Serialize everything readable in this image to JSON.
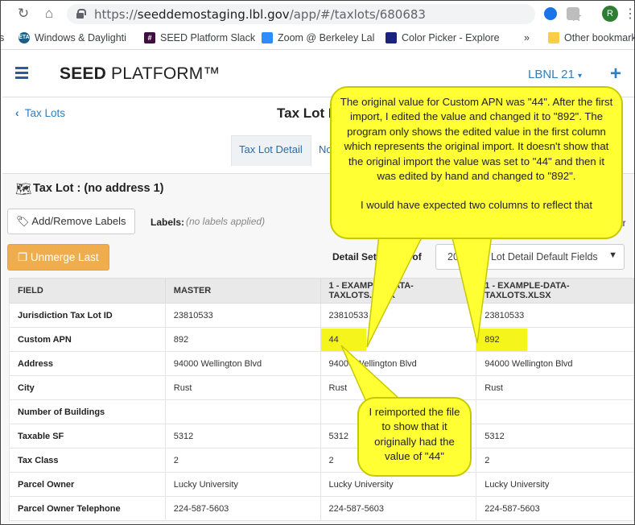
{
  "browser": {
    "url_host": "seeddemostaging.lbl.gov",
    "url_path": "/app/#/taxlots/680683",
    "url_scheme": "https://",
    "avatar_letter": "R",
    "bookmarks": [
      {
        "label": "Windows & Daylighti",
        "icon": "ETA"
      },
      {
        "label": "SEED Platform Slack",
        "icon": "#"
      },
      {
        "label": "Zoom @ Berkeley Lal",
        "icon": "zoom"
      },
      {
        "label": "Color Picker - Explore",
        "icon": "color"
      }
    ],
    "overflow": "»",
    "other_bookmarks": "Other bookmark"
  },
  "app": {
    "brand_bold": "SEED",
    "brand_light": " PLATFORM™",
    "org": "LBNL 21",
    "back_link": "Tax Lots",
    "page_title": "Tax Lot D",
    "tabs": [
      "Tax Lot Detail",
      "No"
    ],
    "section_title": "Tax Lot : (no address 1)",
    "labels_button": "Add/Remove Labels",
    "labels_caption": "Labels:",
    "labels_value": "(no labels applied)",
    "unmerge_button": "Unmerge Last",
    "detail_settings_label": "Detail Settings Prof",
    "detail_settings_value": "2016 Tax Lot Detail Default Fields",
    "edge_fragment_1": "t",
    "edge_fragment_2": "ar"
  },
  "table": {
    "headers": [
      "FIELD",
      "MASTER",
      "1 - EXAMPLE-DATA-TAXLOTS.XLSX",
      "1 - EXAMPLE-DATA-TAXLOTS.XLSX"
    ],
    "rows": [
      [
        "Jurisdiction Tax Lot ID",
        "23810533",
        "23810533",
        "23810533"
      ],
      [
        "Custom APN",
        "892",
        "44",
        "892"
      ],
      [
        "Address",
        "94000 Wellington Blvd",
        "94000 Wellington Blvd",
        "94000 Wellington Blvd"
      ],
      [
        "City",
        "Rust",
        "Rust",
        "Rust"
      ],
      [
        "Number of Buildings",
        "",
        "",
        ""
      ],
      [
        "Taxable SF",
        "5312",
        "5312",
        "5312"
      ],
      [
        "Tax Class",
        "2",
        "2",
        "2"
      ],
      [
        "Parcel Owner",
        "Lucky University",
        "Lucky University",
        "Lucky University"
      ],
      [
        "Parcel Owner Telephone",
        "224-587-5603",
        "224-587-5603",
        "224-587-5603"
      ]
    ]
  },
  "annotations": {
    "callout_top": "The original value for Custom APN was \"44\". After the first import, I edited the value and changed it to \"892\". The program only shows the edited value in the first column which represents the original import. It doesn't show that the original import the value was set to \"44\" and then it was edited by hand and changed to \"892\".",
    "callout_top_2": "I would have expected two columns to reflect that",
    "callout_bottom": "I reimported the file to show that it originally had the value of \"44\"",
    "highlight_color": "#ffff33"
  }
}
